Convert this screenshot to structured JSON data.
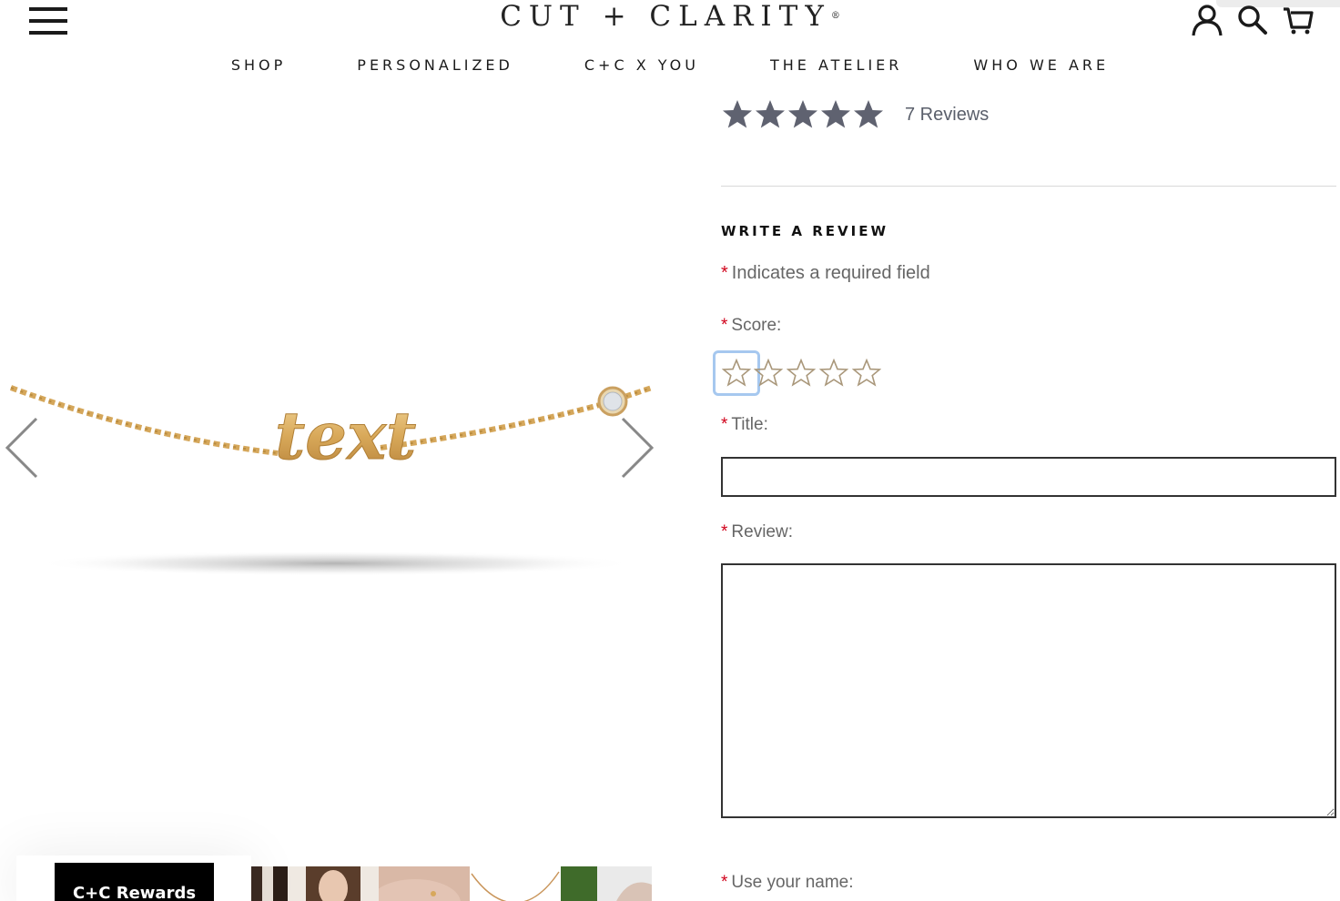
{
  "header": {
    "logo_text": "CUT + CLARITY",
    "logo_mark": "®",
    "menu_icon": "hamburger-menu-icon",
    "icons": [
      "account-icon",
      "search-icon",
      "cart-icon"
    ]
  },
  "nav": {
    "items": [
      {
        "label": "SHOP"
      },
      {
        "label": "PERSONALIZED"
      },
      {
        "label": "C+C X YOU"
      },
      {
        "label": "THE ATELIER"
      },
      {
        "label": "WHO WE ARE"
      }
    ]
  },
  "gallery": {
    "product_image_text": "text",
    "prev_icon": "chevron-left-icon",
    "next_icon": "chevron-right-icon",
    "thumbnail_count": 5
  },
  "rewards": {
    "label": "C+C Rewards"
  },
  "rating": {
    "stars_filled": 5,
    "stars_total": 5,
    "reviews_label": "7 Reviews",
    "star_color": "#5f6270"
  },
  "review_form": {
    "heading": "WRITE A REVIEW",
    "required_note": "Indicates a required field",
    "asterisk": "*",
    "score_label": "Score:",
    "score_selected": 0,
    "score_options": 5,
    "title_label": "Title:",
    "title_value": "",
    "review_label": "Review:",
    "review_value": "",
    "name_label": "Use your name:",
    "star_outline_color": "#a9977a",
    "required_color": "#d0021b"
  }
}
